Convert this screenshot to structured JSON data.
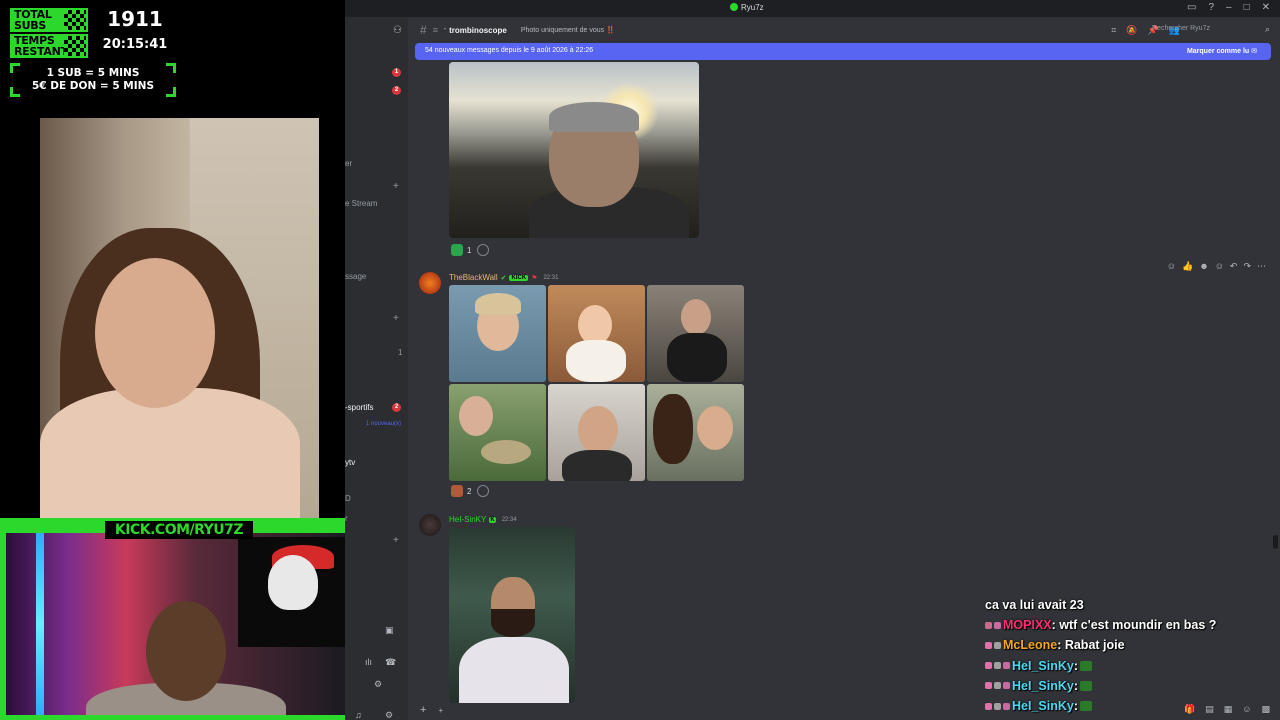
{
  "overlay": {
    "total_subs_label_1": "TOTAL",
    "total_subs_label_2": "SUBS",
    "total_subs_value": "1911",
    "time_left_label_1": "TEMPS",
    "time_left_label_2": "RESTANT",
    "time_left_value": "20:15:41",
    "rule_1": "1 SUB = 5 MINS",
    "rule_2": "5€ DE DON = 5 MINS",
    "kick_url": "KICK.COM/RYU7Z",
    "accent": "#2bd82b"
  },
  "app": {
    "window_title": "Ryu7z",
    "channel_name": "trombinoscope",
    "channel_topic": "Photo uniquement de vous",
    "channel_topic_suffix": "‼️",
    "search_placeholder": "Rechercher Ryu7z",
    "new_messages_text": "54 nouveaux messages depuis le 9 août 2026 à 22:26",
    "mark_read_label": "Marquer comme lu",
    "brand_color": "#5865f2"
  },
  "sidebar": {
    "badge_1": "1",
    "badge_2": "2",
    "item_stream": "e Stream",
    "item_message": "ssage",
    "item_er": "er",
    "count_1": "1",
    "item_sportifs": "-sportifs",
    "badge_sportifs": "2",
    "new_label": "1 nouveau(x)",
    "item_ytv": "ytv",
    "item_d": "D",
    "item_r": "r"
  },
  "messages": [
    {
      "reactions": [
        {
          "emoji": "check-mark",
          "count": "1"
        }
      ]
    },
    {
      "author": "TheBlackWall",
      "author_color": "#e8b86a",
      "badge": "KICK",
      "time": "22:31",
      "reactions": [
        {
          "emoji": "person",
          "count": "2"
        }
      ]
    },
    {
      "author": "HeI-SinKY",
      "author_color": "#2bd82b",
      "time": "22:34"
    }
  ],
  "stream_chat": [
    {
      "user": "",
      "text": "ca va lui avait 23",
      "color": "#ffffff"
    },
    {
      "user": "MOPIXX",
      "text": ": wtf c'est moundir en bas ?",
      "color": "#ff2d6f"
    },
    {
      "user": "McLeone",
      "text": ": Rabat joie",
      "color": "#f5a623"
    },
    {
      "user": "HeI_SinKy",
      "text": ":",
      "color": "#4fd8f0"
    },
    {
      "user": "HeI_SinKy",
      "text": ":",
      "color": "#4fd8f0"
    },
    {
      "user": "HeI_SinKy",
      "text": ":",
      "color": "#4fd8f0"
    }
  ]
}
